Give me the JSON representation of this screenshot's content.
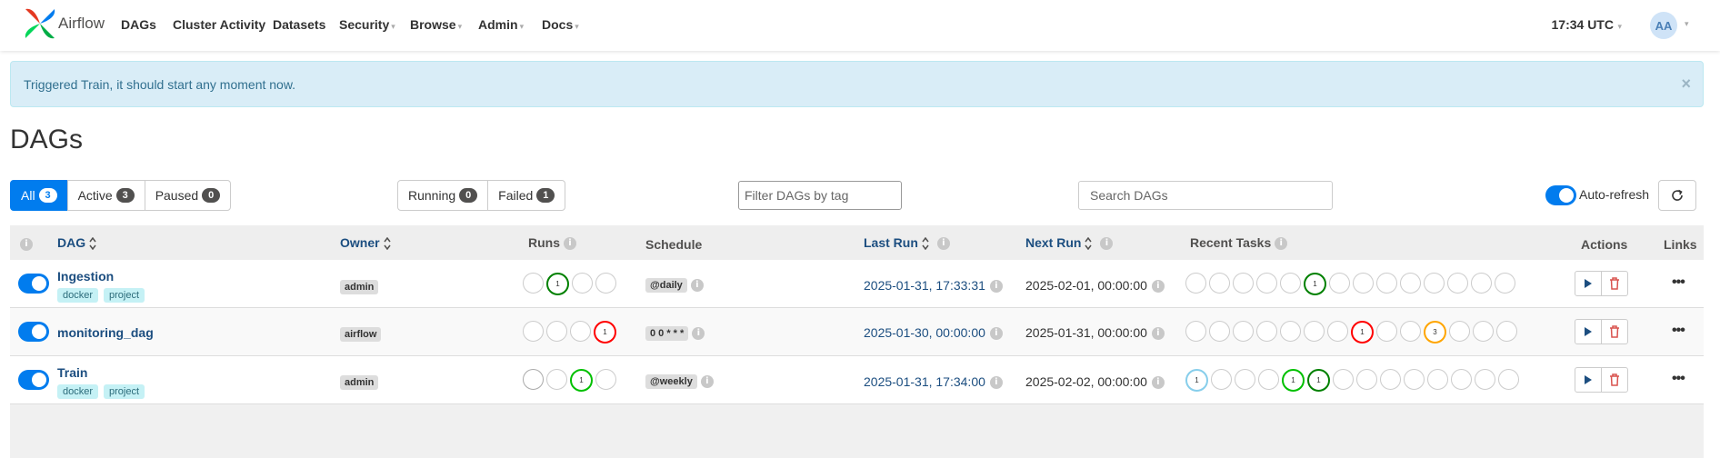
{
  "nav": {
    "brand": "Airflow",
    "items": [
      {
        "label": "DAGs",
        "caret": false
      },
      {
        "label": "Cluster Activity",
        "caret": false
      },
      {
        "label": "Datasets",
        "caret": false
      },
      {
        "label": "Security",
        "caret": true
      },
      {
        "label": "Browse",
        "caret": true
      },
      {
        "label": "Admin",
        "caret": true
      },
      {
        "label": "Docs",
        "caret": true
      }
    ],
    "clock": "17:34 UTC",
    "avatar_initials": "AA"
  },
  "alert": {
    "message": "Triggered Train, it should start any moment now.",
    "close_glyph": "×"
  },
  "page_title": "DAGs",
  "filters": {
    "status": [
      {
        "label": "All",
        "count": "3",
        "active": true
      },
      {
        "label": "Active",
        "count": "3",
        "active": false
      },
      {
        "label": "Paused",
        "count": "0",
        "active": false
      }
    ],
    "state": [
      {
        "label": "Running",
        "count": "0"
      },
      {
        "label": "Failed",
        "count": "1"
      }
    ],
    "tag_placeholder": "Filter DAGs by tag",
    "search_placeholder": "Search DAGs",
    "auto_refresh_label": "Auto-refresh",
    "auto_refresh_on": true
  },
  "table": {
    "headers": {
      "dag": "DAG",
      "owner": "Owner",
      "runs": "Runs",
      "schedule": "Schedule",
      "last_run": "Last Run",
      "next_run": "Next Run",
      "recent_tasks": "Recent Tasks",
      "actions": "Actions",
      "links": "Links"
    },
    "info_glyph": "i",
    "more_glyph": "•••",
    "rows": [
      {
        "name": "Ingestion",
        "tags": [
          "docker",
          "project"
        ],
        "owner": "admin",
        "schedule": "@daily",
        "last_run": "2025-01-31, 17:33:31",
        "next_run": "2025-02-01, 00:00:00",
        "runs": [
          {
            "count": "",
            "color": "#cccccc"
          },
          {
            "count": "1",
            "color": "#008000"
          },
          {
            "count": "",
            "color": "#cccccc"
          },
          {
            "count": "",
            "color": "#cccccc"
          }
        ],
        "tasks": [
          {
            "count": "",
            "color": "#cccccc"
          },
          {
            "count": "",
            "color": "#cccccc"
          },
          {
            "count": "",
            "color": "#cccccc"
          },
          {
            "count": "",
            "color": "#cccccc"
          },
          {
            "count": "",
            "color": "#cccccc"
          },
          {
            "count": "1",
            "color": "#008000"
          },
          {
            "count": "",
            "color": "#cccccc"
          },
          {
            "count": "",
            "color": "#cccccc"
          },
          {
            "count": "",
            "color": "#cccccc"
          },
          {
            "count": "",
            "color": "#cccccc"
          },
          {
            "count": "",
            "color": "#cccccc"
          },
          {
            "count": "",
            "color": "#cccccc"
          },
          {
            "count": "",
            "color": "#cccccc"
          },
          {
            "count": "",
            "color": "#cccccc"
          }
        ]
      },
      {
        "name": "monitoring_dag",
        "tags": [],
        "owner": "airflow",
        "schedule": "0 0 * * *",
        "last_run": "2025-01-30, 00:00:00",
        "next_run": "2025-01-31, 00:00:00",
        "runs": [
          {
            "count": "",
            "color": "#cccccc"
          },
          {
            "count": "",
            "color": "#cccccc"
          },
          {
            "count": "",
            "color": "#cccccc"
          },
          {
            "count": "1",
            "color": "#ff0000"
          }
        ],
        "tasks": [
          {
            "count": "",
            "color": "#cccccc"
          },
          {
            "count": "",
            "color": "#cccccc"
          },
          {
            "count": "",
            "color": "#cccccc"
          },
          {
            "count": "",
            "color": "#cccccc"
          },
          {
            "count": "",
            "color": "#cccccc"
          },
          {
            "count": "",
            "color": "#cccccc"
          },
          {
            "count": "",
            "color": "#cccccc"
          },
          {
            "count": "1",
            "color": "#ff0000"
          },
          {
            "count": "",
            "color": "#cccccc"
          },
          {
            "count": "",
            "color": "#cccccc"
          },
          {
            "count": "3",
            "color": "#ffa500"
          },
          {
            "count": "",
            "color": "#cccccc"
          },
          {
            "count": "",
            "color": "#cccccc"
          },
          {
            "count": "",
            "color": "#cccccc"
          }
        ]
      },
      {
        "name": "Train",
        "tags": [
          "docker",
          "project"
        ],
        "owner": "admin",
        "schedule": "@weekly",
        "last_run": "2025-01-31, 17:34:00",
        "next_run": "2025-02-02, 00:00:00",
        "runs": [
          {
            "count": "",
            "color": "#aaaaaa"
          },
          {
            "count": "",
            "color": "#cccccc"
          },
          {
            "count": "1",
            "color": "#00c000"
          },
          {
            "count": "",
            "color": "#cccccc"
          }
        ],
        "tasks": [
          {
            "count": "1",
            "color": "#87ceeb"
          },
          {
            "count": "",
            "color": "#cccccc"
          },
          {
            "count": "",
            "color": "#cccccc"
          },
          {
            "count": "",
            "color": "#cccccc"
          },
          {
            "count": "1",
            "color": "#00c000"
          },
          {
            "count": "1",
            "color": "#008000"
          },
          {
            "count": "",
            "color": "#cccccc"
          },
          {
            "count": "",
            "color": "#cccccc"
          },
          {
            "count": "",
            "color": "#cccccc"
          },
          {
            "count": "",
            "color": "#cccccc"
          },
          {
            "count": "",
            "color": "#cccccc"
          },
          {
            "count": "",
            "color": "#cccccc"
          },
          {
            "count": "",
            "color": "#cccccc"
          },
          {
            "count": "",
            "color": "#cccccc"
          }
        ]
      }
    ]
  },
  "colors": {
    "accent": "#017cee",
    "link": "#1c4e80",
    "alert_bg": "#d9edf7",
    "alert_text": "#31708f",
    "tag_bg": "#c5f1f5",
    "delete_red": "#d9534f"
  }
}
